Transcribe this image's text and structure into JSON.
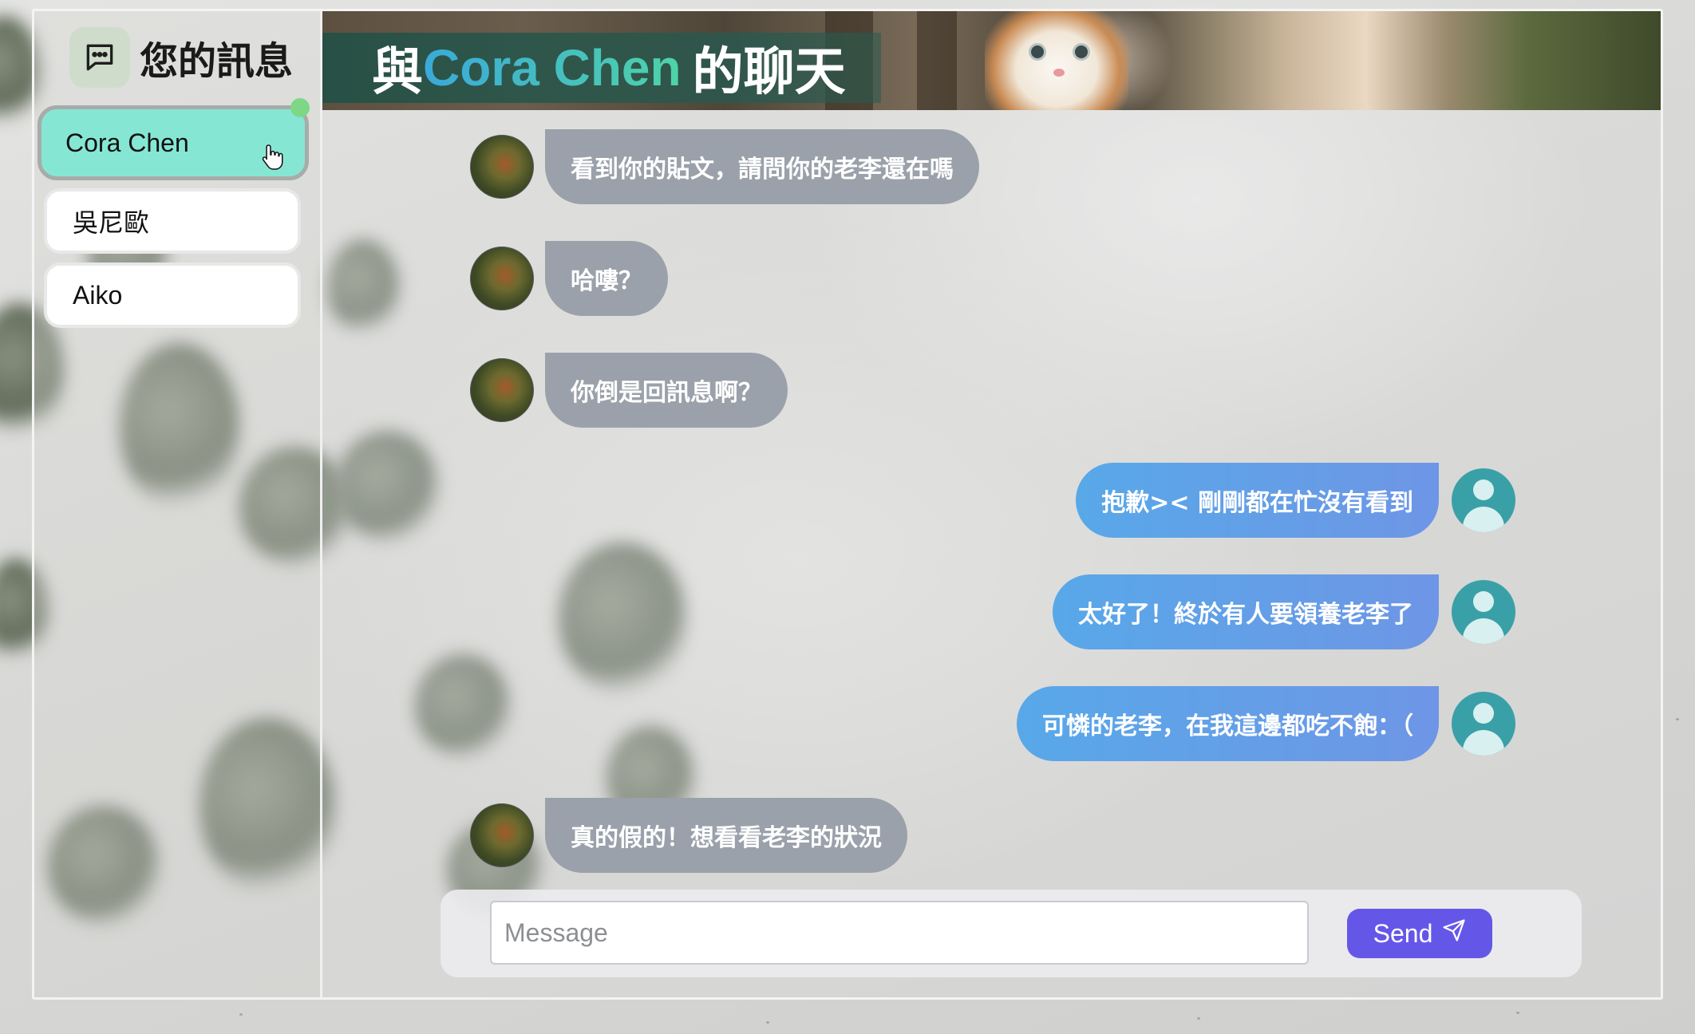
{
  "sidebar": {
    "title": "您的訊息",
    "contacts": [
      {
        "name": "Cora Chen",
        "active": true
      },
      {
        "name": "吳尼歐",
        "active": false
      },
      {
        "name": "Aiko",
        "active": false
      }
    ]
  },
  "chat": {
    "title_prefix": "與",
    "contact_name": "Cora Chen",
    "title_suffix": "的聊天",
    "messages": [
      {
        "from": "other",
        "text": "看到你的貼文，請問你的老李還在嗎"
      },
      {
        "from": "other",
        "text": "哈嘍？"
      },
      {
        "from": "other",
        "text": "你倒是回訊息啊？"
      },
      {
        "from": "me",
        "text": "抱歉>< 剛剛都在忙沒有看到"
      },
      {
        "from": "me",
        "text": "太好了！終於有人要領養老李了"
      },
      {
        "from": "me",
        "text": "可憐的老李，在我這邊都吃不飽：（"
      },
      {
        "from": "other",
        "text": "真的假的！想看看老李的狀況"
      }
    ]
  },
  "composer": {
    "placeholder": "Message",
    "value": "",
    "send_label": "Send",
    "send_icon": "paper-plane-icon"
  },
  "icons": {
    "header_icon": "chat-bubble-icon",
    "cursor": "hand-pointer-icon"
  },
  "colors": {
    "active_contact": "#86e6d4",
    "incoming_bubble": "#9ba1aa",
    "outgoing_bubble": "#58a8e8",
    "send_button": "#6457e8",
    "online_indicator": "#7ed787",
    "user_avatar": "#3aa0a8"
  }
}
